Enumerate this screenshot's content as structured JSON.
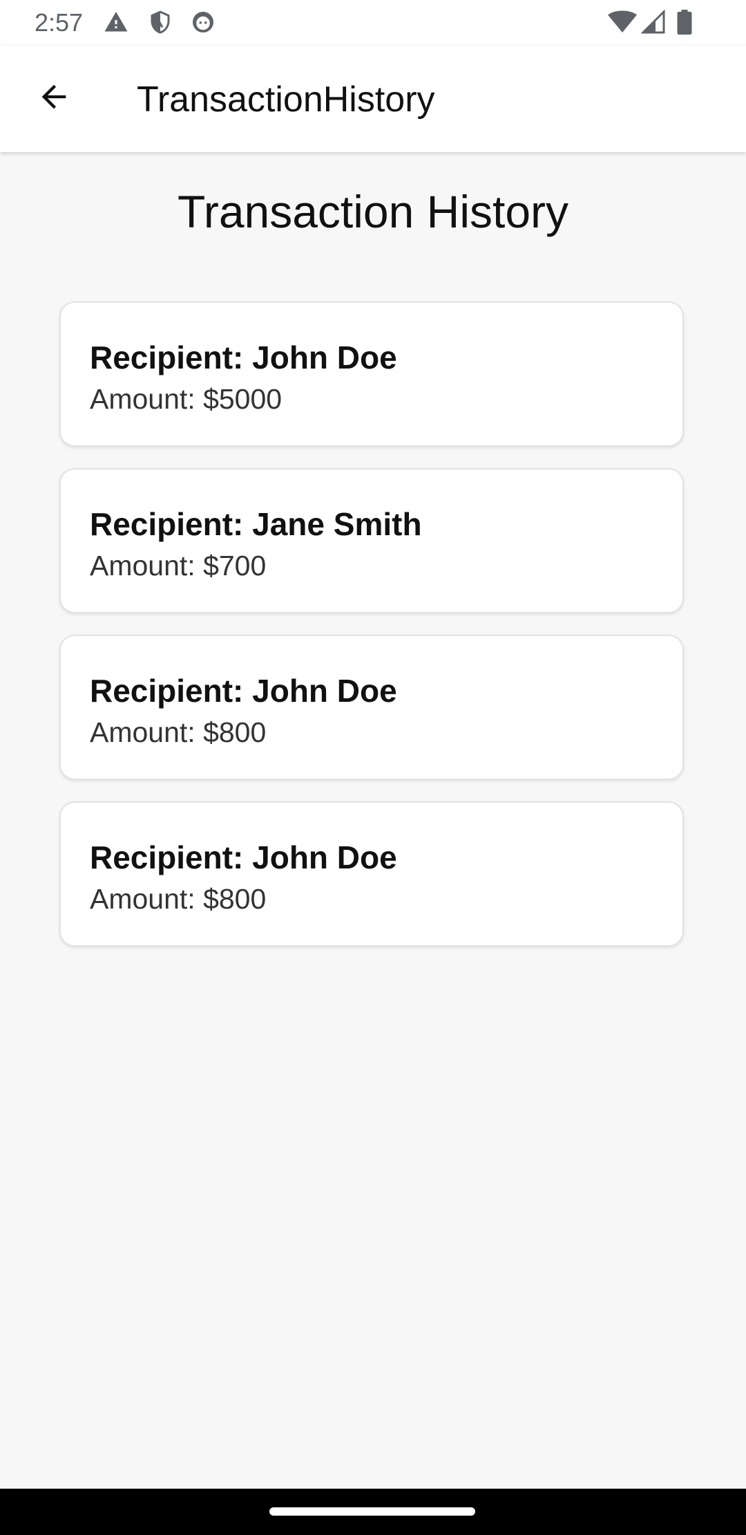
{
  "status_bar": {
    "time": "2:57",
    "left_icons": [
      "warning-icon",
      "shield-icon",
      "face-icon"
    ],
    "right_icons": [
      "wifi-icon",
      "signal-icon",
      "battery-icon"
    ]
  },
  "app_bar": {
    "title": "TransactionHistory",
    "back_icon": "arrow-back-icon"
  },
  "main": {
    "heading": "Transaction History",
    "transactions": [
      {
        "recipient": "Recipient: John Doe",
        "amount": "Amount: $5000"
      },
      {
        "recipient": "Recipient: Jane Smith",
        "amount": "Amount: $700"
      },
      {
        "recipient": "Recipient: John Doe",
        "amount": "Amount: $800"
      },
      {
        "recipient": "Recipient: John Doe",
        "amount": "Amount: $800"
      }
    ]
  },
  "colors": {
    "background": "#f7f7f7",
    "card": "#ffffff",
    "app_bar": "#ffffff",
    "nav_bar": "#000000"
  }
}
